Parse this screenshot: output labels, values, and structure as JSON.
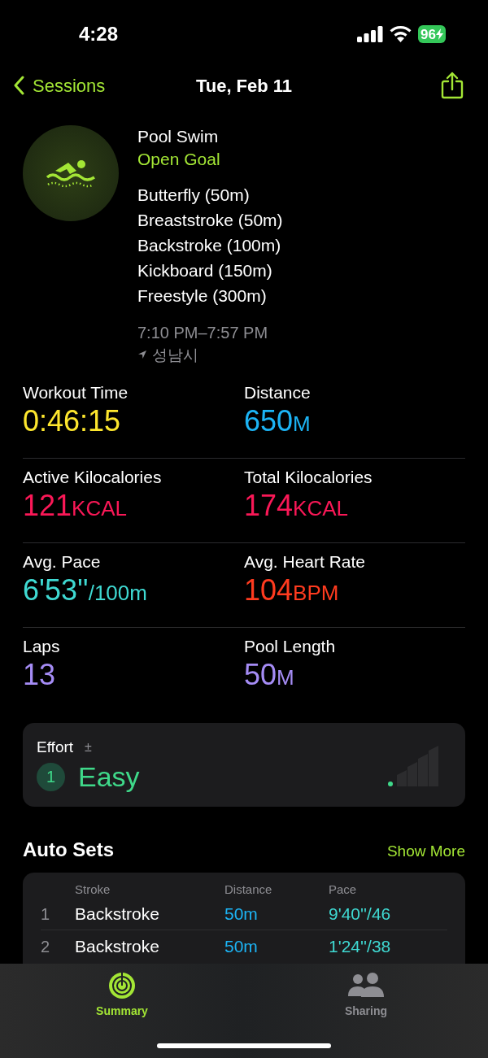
{
  "status_bar": {
    "time": "4:28",
    "battery": "96"
  },
  "nav": {
    "back": "Sessions",
    "title": "Tue, Feb 11"
  },
  "workout": {
    "type": "Pool Swim",
    "goal": "Open Goal",
    "strokes": [
      "Butterfly (50m)",
      "Breaststroke (50m)",
      "Backstroke (100m)",
      "Kickboard (150m)",
      "Freestyle (300m)"
    ],
    "time_range": "7:10 PM–7:57 PM",
    "location": "성남시"
  },
  "metrics": [
    {
      "label": "Workout Time",
      "value": "0:46:15",
      "color": "#fde62e"
    },
    {
      "label": "Distance",
      "value": "650",
      "unit": "M",
      "color": "#1cb4f5"
    },
    {
      "label": "Active Kilocalories",
      "value": "121",
      "unit": "KCAL",
      "color": "#fa1857"
    },
    {
      "label": "Total Kilocalories",
      "value": "174",
      "unit": "KCAL",
      "color": "#fa1857"
    },
    {
      "label": "Avg. Pace",
      "value": "6'53''",
      "unit": "/100m",
      "color": "#3fd9d2"
    },
    {
      "label": "Avg. Heart Rate",
      "value": "104",
      "unit": "BPM",
      "color": "#ff3b1f"
    },
    {
      "label": "Laps",
      "value": "13",
      "color": "#a58cf5"
    },
    {
      "label": "Pool Length",
      "value": "50",
      "unit": "M",
      "color": "#a58cf5"
    }
  ],
  "effort": {
    "title": "Effort",
    "symbol": "±",
    "score": "1",
    "rating": "Easy"
  },
  "auto_sets": {
    "title": "Auto Sets",
    "action": "Show More",
    "columns": [
      "Stroke",
      "Distance",
      "Pace"
    ],
    "rows": [
      {
        "index": "1",
        "stroke": "Backstroke",
        "distance": "50m",
        "pace": "9'40''/46"
      },
      {
        "index": "2",
        "stroke": "Backstroke",
        "distance": "50m",
        "pace": "1'24''/38"
      }
    ]
  },
  "tab_bar": [
    {
      "label": "Summary",
      "kind": "summary",
      "selected": true
    },
    {
      "label": "Sharing",
      "kind": "sharing",
      "selected": false
    }
  ]
}
